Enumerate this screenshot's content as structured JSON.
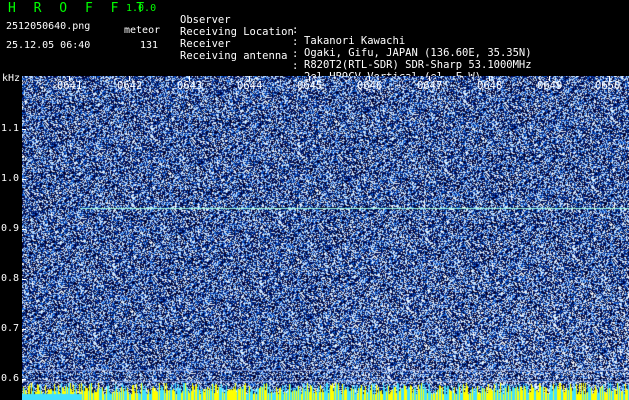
{
  "colors": {
    "title": "#00ff00",
    "text": "#ffffff",
    "info": "#ffffff",
    "axis": "#ffffff",
    "trace": "#9fffe0",
    "bottom_band": "#ffff00"
  },
  "header": {
    "app_name": "H R O F F T",
    "app_version": "1.0.0",
    "file_name": "2512050640.png",
    "timestamp": "25.12.05 06:40",
    "meteor_label": "meteor",
    "meteor_count": "131"
  },
  "info": [
    {
      "label": "Observer",
      "sep": ":",
      "value": "Takanori Kawachi"
    },
    {
      "label": "Receiving Location",
      "sep": ":",
      "value": "Ogaki, Gifu, JAPAN (136.60E, 35.35N)"
    },
    {
      "label": "Receiver",
      "sep": ":",
      "value": "R820T2(RTL-SDR) SDR-Sharp 53.1000MHz"
    },
    {
      "label": "Receiving antenna",
      "sep": ":",
      "value": "2el-HB9CV Vertical (el. E-W)"
    }
  ],
  "axes": {
    "y_unit": "kHz",
    "y_ticks": [
      "1.1",
      "1.0",
      "0.9",
      "0.8",
      "0.7",
      "0.6"
    ],
    "x_ticks": [
      "0641",
      "0642",
      "0643",
      "0644",
      "0645",
      "0646",
      "0647",
      "0648",
      "0649",
      "0650"
    ]
  },
  "spectrogram": {
    "carrier_khz": 0.93,
    "freq_range_khz": [
      0.58,
      1.18
    ],
    "time_range": [
      "06:40",
      "06:50"
    ]
  }
}
